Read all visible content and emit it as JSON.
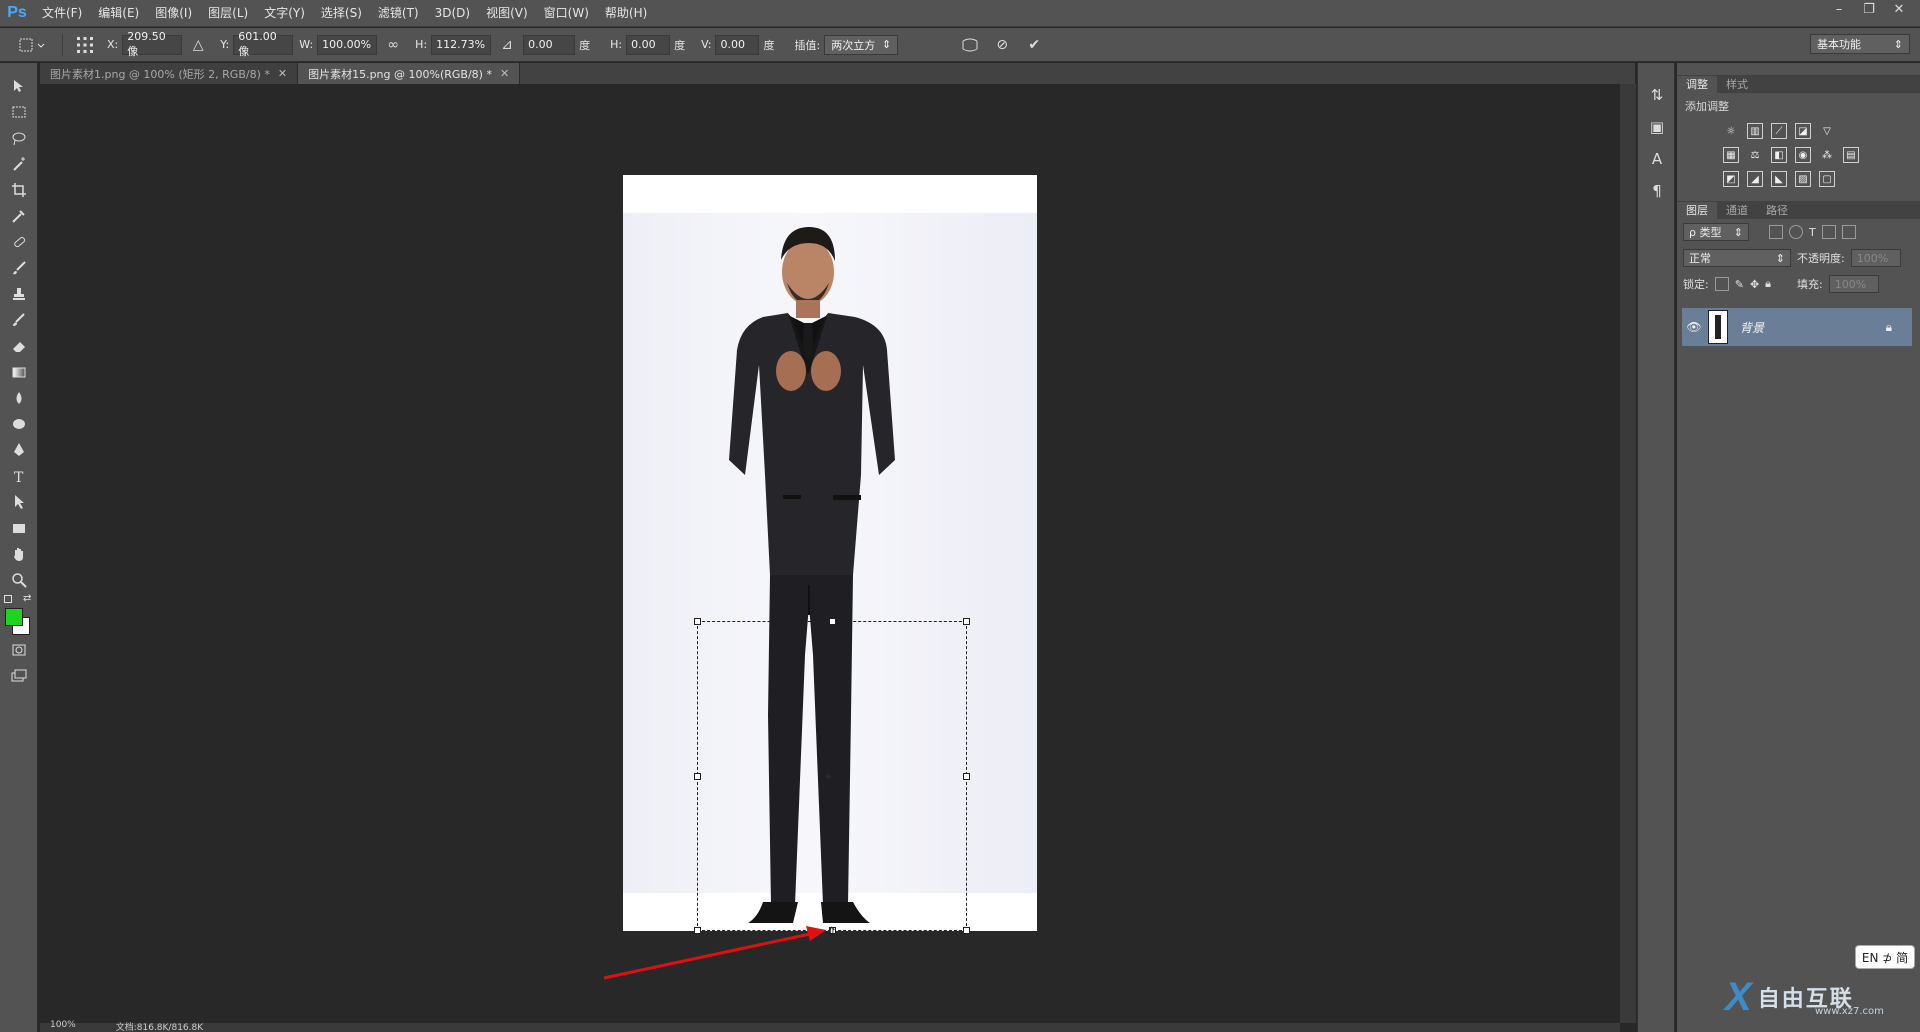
{
  "app": {
    "logo": "Ps"
  },
  "menu": [
    "文件(F)",
    "编辑(E)",
    "图像(I)",
    "图层(L)",
    "文字(Y)",
    "选择(S)",
    "滤镜(T)",
    "3D(D)",
    "视图(V)",
    "窗口(W)",
    "帮助(H)"
  ],
  "window_controls": {
    "minimize": "–",
    "restore": "❐",
    "close": "✕"
  },
  "options": {
    "x_label": "X:",
    "x_value": "209.50 像",
    "y_label": "Y:",
    "y_value": "601.00 像",
    "w_label": "W:",
    "w_value": "100.00%",
    "h_label": "H:",
    "h_value": "112.73%",
    "angle_value": "0.00",
    "angle_unit": "度",
    "hskew_label": "H:",
    "hskew_value": "0.00",
    "hskew_unit": "度",
    "vskew_label": "V:",
    "vskew_value": "0.00",
    "vskew_unit": "度",
    "interp_label": "插值:",
    "interp_value": "两次立方",
    "workspace": "基本功能"
  },
  "tabs": [
    {
      "label": "图片素材1.png @ 100% (矩形 2, RGB/8) *",
      "active": false
    },
    {
      "label": "图片素材15.png @ 100%(RGB/8) *",
      "active": true
    }
  ],
  "status": {
    "zoom": "100%",
    "doc": "文档:816.8K/816.8K"
  },
  "panels": {
    "adjust_tabs": [
      "调整",
      "样式"
    ],
    "adjust_title": "添加调整",
    "layers_tabs": [
      "图层",
      "通道",
      "路径"
    ],
    "filter_kind": "ρ 类型",
    "blend_mode": "正常",
    "opacity_label": "不透明度:",
    "opacity_value": "100%",
    "lock_label": "锁定:",
    "fill_label": "填充:",
    "fill_value": "100%",
    "layer_name": "背景"
  },
  "ime": "EN ⊅ 简",
  "watermark": {
    "brand": "自由互联",
    "url": "www.xz7.com"
  },
  "colors": {
    "foreground": "#21d321",
    "background": "#ffffff",
    "arrow": "#e01010",
    "layer_highlight": "#6b7e98"
  }
}
